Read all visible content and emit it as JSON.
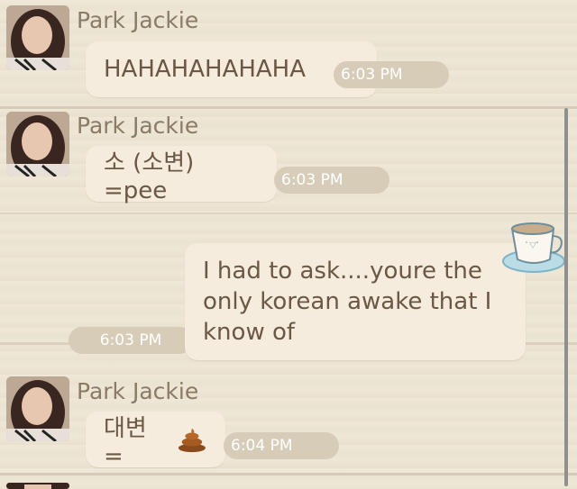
{
  "messages": [
    {
      "sender": "Park Jackie",
      "text": "HAHAHAHAHAHA",
      "time": "6:03 PM"
    },
    {
      "sender": "Park Jackie",
      "text": "소 (소변) =pee",
      "time": "6:03 PM"
    },
    {
      "text_lines": [
        "I had to ask....youre the",
        "only korean awake that I",
        "know of"
      ],
      "time": "6:03 PM",
      "sticker": "coffee-cup-icon"
    },
    {
      "sender": "Park Jackie",
      "text": "대변 =",
      "emoji": "poop-emoji-icon",
      "time": "6:04 PM"
    }
  ],
  "colors": {
    "bubble": "#f5ecdd",
    "time_pill": "#d7ccb8",
    "text": "#6b5744",
    "sender": "#8a7a66"
  }
}
